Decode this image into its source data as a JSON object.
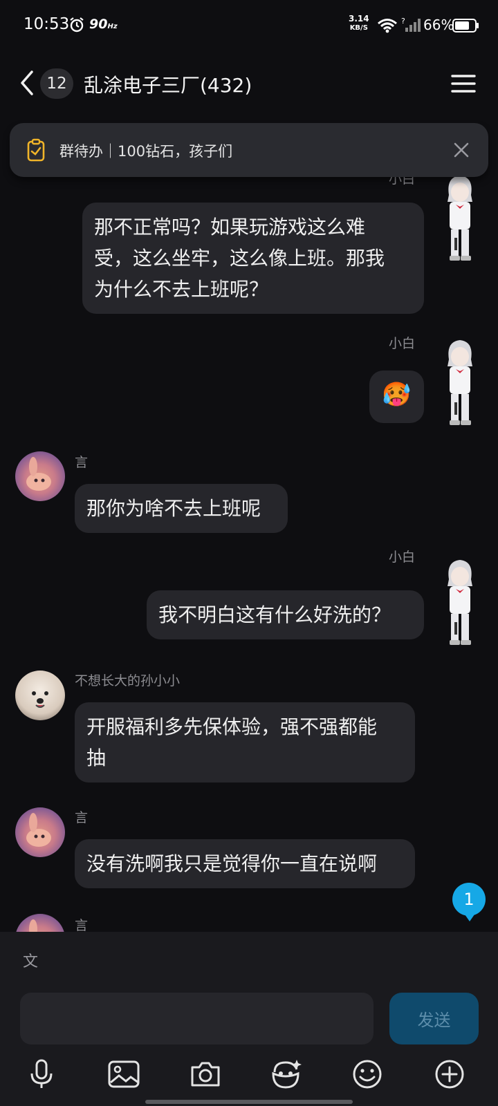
{
  "status_bar": {
    "time": "10:53",
    "refresh_rate": "90",
    "refresh_unit": "Hz",
    "net_speed_value": "3.14",
    "net_speed_unit": "KB/S",
    "signal_unknown": "?",
    "battery": "66%"
  },
  "header": {
    "unread_count": "12",
    "title": "乱涂电子三厂(432)"
  },
  "todo_banner": {
    "text": "群待办｜100钻石，孩子们"
  },
  "messages": [
    {
      "sender": "小白",
      "text": "那不正常吗？如果玩游戏这么难\n受，这么坐牢，这么像上班。那我\n为什么不去上班呢？"
    },
    {
      "sender": "小白",
      "text": "🥵"
    },
    {
      "sender": "言",
      "text": "那你为啥不去上班呢"
    },
    {
      "sender": "小白",
      "text": "我不明白这有什么好洗的？"
    },
    {
      "sender": "不想长大的孙小小",
      "text": "开服福利多先保体验，强不强都能\n抽"
    },
    {
      "sender": "言",
      "text": "没有洗啊我只是觉得你一直在说啊"
    },
    {
      "sender": "言",
      "text": ""
    }
  ],
  "new_message_badge": "1",
  "composer": {
    "placeholder": "",
    "value": "",
    "send_label": "发送",
    "translate_glyph": "文"
  },
  "toolbar": [
    "mic-icon",
    "image-icon",
    "camera-icon",
    "sticker-icon",
    "emoji-icon",
    "plus-icon"
  ],
  "colors": {
    "background": "#0e0e11",
    "bubble": "#26262b",
    "accent": "#16a8e6",
    "send_button": "#0f4a6c"
  }
}
